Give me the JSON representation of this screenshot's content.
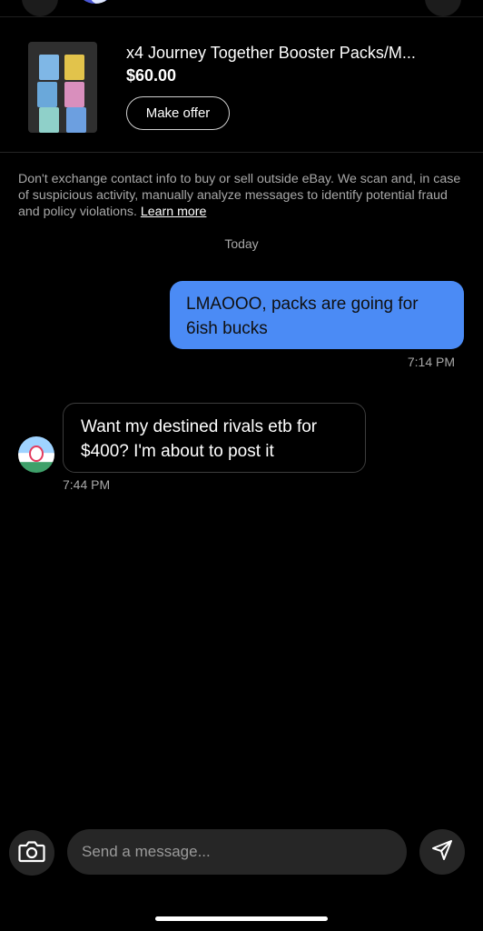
{
  "listing": {
    "title": "x4 Journey Together Booster Packs/M...",
    "price": "$60.00",
    "make_offer_label": "Make offer"
  },
  "notice": {
    "text": "Don't exchange contact info to buy or sell outside eBay. We scan and, in case of suspicious activity, manually analyze messages to identify potential fraud and policy violations. ",
    "link_label": "Learn more"
  },
  "date_separator": "Today",
  "messages": [
    {
      "direction": "outgoing",
      "text": "LMAOOO, packs are going for 6ish bucks",
      "time": "7:14 PM"
    },
    {
      "direction": "incoming",
      "text": "Want my destined rivals etb for $400? I'm about to post it",
      "time": "7:44 PM"
    }
  ],
  "composer": {
    "placeholder": "Send a message...",
    "camera_icon": "camera-icon",
    "send_icon": "send-icon"
  },
  "colors": {
    "outgoing_bubble": "#4b8bf5",
    "background": "#000000"
  }
}
